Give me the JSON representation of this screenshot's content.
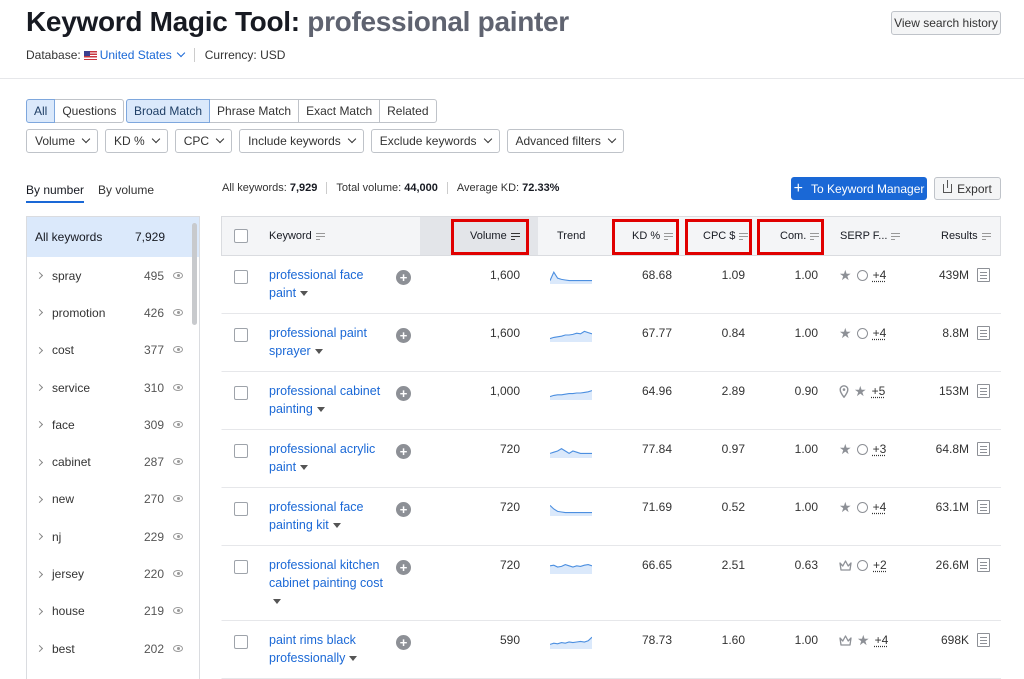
{
  "header": {
    "title": "Keyword Magic Tool:",
    "query": "professional painter",
    "database_label": "Database:",
    "database_value": "United States",
    "currency": "Currency: USD",
    "history_button": "View search history"
  },
  "match_tabs": {
    "group1": [
      {
        "label": "All",
        "active": true
      },
      {
        "label": "Questions",
        "active": false
      }
    ],
    "group2": [
      {
        "label": "Broad Match",
        "active": true
      },
      {
        "label": "Phrase Match",
        "active": false
      },
      {
        "label": "Exact Match",
        "active": false
      },
      {
        "label": "Related",
        "active": false
      }
    ]
  },
  "filters": [
    "Volume",
    "KD %",
    "CPC",
    "Include keywords",
    "Exclude keywords",
    "Advanced filters"
  ],
  "sidebar": {
    "tabs": [
      "By number",
      "By volume"
    ],
    "all_label": "All keywords",
    "all_count": "7,929",
    "items": [
      {
        "label": "spray",
        "count": "495"
      },
      {
        "label": "promotion",
        "count": "426"
      },
      {
        "label": "cost",
        "count": "377"
      },
      {
        "label": "service",
        "count": "310"
      },
      {
        "label": "face",
        "count": "309"
      },
      {
        "label": "cabinet",
        "count": "287"
      },
      {
        "label": "new",
        "count": "270"
      },
      {
        "label": "nj",
        "count": "229"
      },
      {
        "label": "jersey",
        "count": "220"
      },
      {
        "label": "house",
        "count": "219"
      },
      {
        "label": "best",
        "count": "202"
      }
    ]
  },
  "summary": {
    "all_keywords_label": "All keywords:",
    "all_keywords_value": "7,929",
    "total_volume_label": "Total volume:",
    "total_volume_value": "44,000",
    "avg_kd_label": "Average KD:",
    "avg_kd_value": "72.33%"
  },
  "actions": {
    "keyword_manager": "To Keyword Manager",
    "export": "Export"
  },
  "table": {
    "headers": {
      "keyword": "Keyword",
      "volume": "Volume",
      "trend": "Trend",
      "kd": "KD %",
      "cpc": "CPC $",
      "com": "Com.",
      "serp": "SERP F...",
      "results": "Results"
    },
    "rows": [
      {
        "kw1": "professional face",
        "kw2": "paint",
        "kw3": "",
        "volume": "1,600",
        "kd": "68.68",
        "cpc": "1.09",
        "com": "1.00",
        "serp": [
          "star-icon",
          "link-icon"
        ],
        "serp_more": "+4",
        "results": "439M",
        "trend": [
          0.2,
          0.9,
          0.4,
          0.3,
          0.25,
          0.2,
          0.2,
          0.2,
          0.2,
          0.2,
          0.2,
          0.2
        ]
      },
      {
        "kw1": "professional paint",
        "kw2": "sprayer",
        "kw3": "",
        "volume": "1,600",
        "kd": "67.77",
        "cpc": "0.84",
        "com": "1.00",
        "serp": [
          "star-icon",
          "link-icon"
        ],
        "serp_more": "+4",
        "results": "8.8M",
        "trend": [
          0.2,
          0.3,
          0.35,
          0.4,
          0.5,
          0.5,
          0.55,
          0.65,
          0.6,
          0.8,
          0.7,
          0.6
        ]
      },
      {
        "kw1": "professional cabinet",
        "kw2": "painting",
        "kw3": "",
        "volume": "1,000",
        "kd": "64.96",
        "cpc": "2.89",
        "com": "0.90",
        "serp": [
          "pin-icon",
          "star-icon"
        ],
        "serp_more": "+5",
        "results": "153M",
        "trend": [
          0.2,
          0.3,
          0.35,
          0.35,
          0.4,
          0.45,
          0.45,
          0.5,
          0.5,
          0.55,
          0.6,
          0.7
        ]
      },
      {
        "kw1": "professional acrylic",
        "kw2": "paint",
        "kw3": "",
        "volume": "720",
        "kd": "77.84",
        "cpc": "0.97",
        "com": "1.00",
        "serp": [
          "star-icon",
          "link-icon"
        ],
        "serp_more": "+3",
        "results": "64.8M",
        "trend": [
          0.3,
          0.4,
          0.5,
          0.7,
          0.5,
          0.3,
          0.5,
          0.4,
          0.3,
          0.3,
          0.3,
          0.3
        ]
      },
      {
        "kw1": "professional face",
        "kw2": "painting kit",
        "kw3": "",
        "volume": "720",
        "kd": "71.69",
        "cpc": "0.52",
        "com": "1.00",
        "serp": [
          "star-icon",
          "link-icon"
        ],
        "serp_more": "+4",
        "results": "63.1M",
        "trend": [
          0.8,
          0.5,
          0.3,
          0.25,
          0.2,
          0.2,
          0.2,
          0.2,
          0.2,
          0.2,
          0.2,
          0.2
        ]
      },
      {
        "kw1": "professional kitchen",
        "kw2": "cabinet painting cost",
        "kw3": "",
        "volume": "720",
        "kd": "66.65",
        "cpc": "2.51",
        "com": "0.63",
        "serp": [
          "crown-icon",
          "link-icon"
        ],
        "serp_more": "+2",
        "results": "26.6M",
        "trend": [
          0.6,
          0.65,
          0.5,
          0.55,
          0.7,
          0.6,
          0.5,
          0.6,
          0.55,
          0.65,
          0.7,
          0.6
        ]
      },
      {
        "kw1": "paint rims black",
        "kw2": "professionally",
        "kw3": "",
        "volume": "590",
        "kd": "78.73",
        "cpc": "1.60",
        "com": "1.00",
        "serp": [
          "crown-icon",
          "star-icon"
        ],
        "serp_more": "+4",
        "results": "698K",
        "trend": [
          0.3,
          0.4,
          0.35,
          0.45,
          0.4,
          0.5,
          0.45,
          0.5,
          0.55,
          0.5,
          0.6,
          0.9
        ]
      }
    ]
  }
}
